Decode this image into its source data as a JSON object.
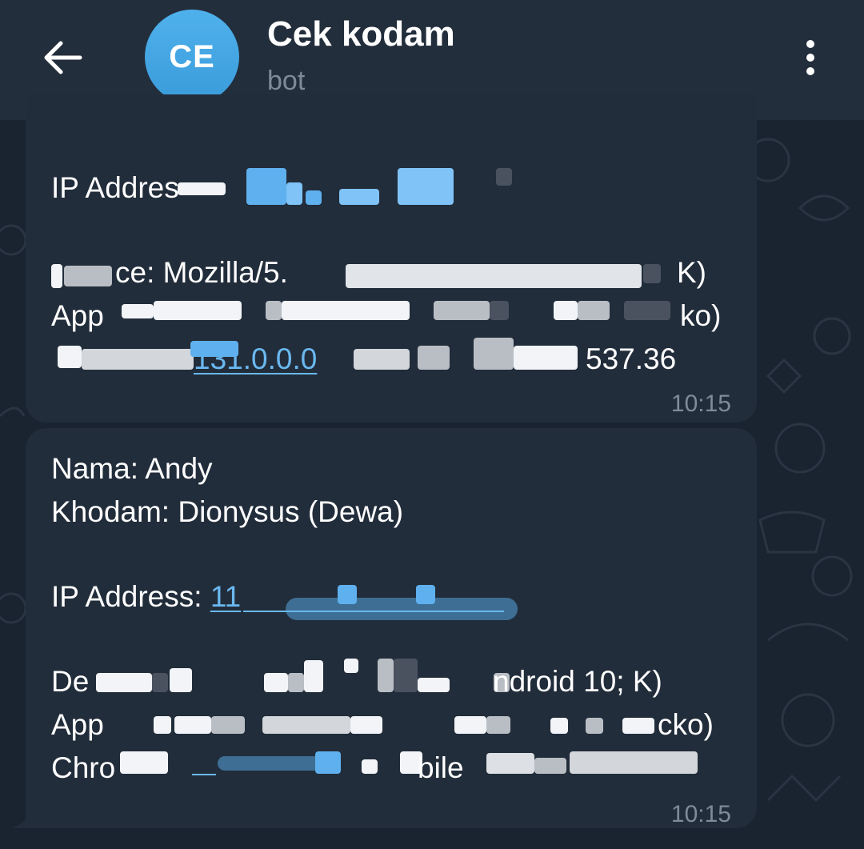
{
  "header": {
    "back_icon": "arrow-left-icon",
    "avatar_initials": "CE",
    "title": "Cek kodam",
    "subtitle": "bot",
    "menu_icon": "more-vertical-icon"
  },
  "messages": [
    {
      "ip_label": "IP Addres",
      "device_line_1": "ce: Mozilla/5.",
      "device_line_1_end": "K)",
      "device_line_2_start": "App",
      "device_line_2_end": "ko)",
      "device_line_3_link": "131.0.0.0",
      "device_line_3_end": "537.36",
      "time": "10:15"
    },
    {
      "nama": "Nama: Andy",
      "khodam": "Khodam: Dionysus (Dewa)",
      "ip_label": "IP Address: ",
      "ip_value": "11",
      "device_line_1_start": "De",
      "device_line_1_end": "ndroid 10; K)",
      "device_line_2_start": "App",
      "device_line_2_end": "cko)",
      "device_line_3_start": "Chro",
      "device_line_3_mid": "bile",
      "time": "10:15"
    }
  ],
  "colors": {
    "background": "#1a2330",
    "header": "#232e3c",
    "bubble": "#222d3b",
    "avatar": "#46a8e6",
    "link": "#6ab8f0",
    "muted": "#7f8b98"
  }
}
